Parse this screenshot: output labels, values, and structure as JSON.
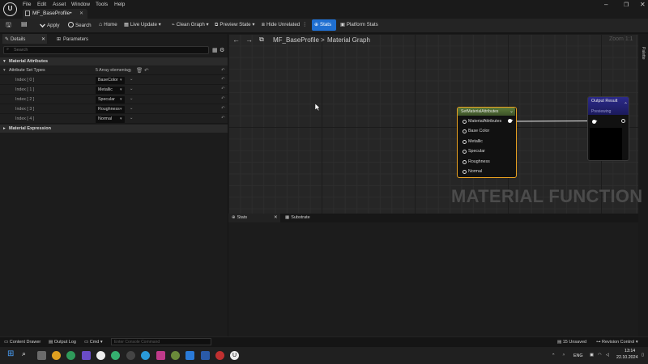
{
  "menu": [
    "File",
    "Edit",
    "Asset",
    "Window",
    "Tools",
    "Help"
  ],
  "document_tab": "MF_BaseProfile•",
  "toolbar": {
    "apply": "Apply",
    "search": "Search",
    "home": "Home",
    "live_update": "Live Update",
    "clean_graph": "Clean Graph",
    "preview_state": "Preview State",
    "hide_unrelated": "Hide Unrelated",
    "stats": "Stats",
    "platform_stats": "Platform Stats"
  },
  "details": {
    "tab_details": "Details",
    "tab_parameters": "Parameters",
    "search_placeholder": "Search",
    "category_material_attributes": "Material Attributes",
    "attribute_set_types_label": "Attribute Set Types",
    "array_count": "5 Array elements",
    "category_material_expression": "Material Expression",
    "rows": [
      {
        "label": "Index [ 0 ]",
        "value": "BaseColor"
      },
      {
        "label": "Index [ 1 ]",
        "value": "Metallic"
      },
      {
        "label": "Index [ 2 ]",
        "value": "Specular"
      },
      {
        "label": "Index [ 3 ]",
        "value": "Roughness"
      },
      {
        "label": "Index [ 4 ]",
        "value": "Normal"
      }
    ]
  },
  "graph": {
    "breadcrumb_asset": "MF_BaseProfile",
    "breadcrumb_separator": ">",
    "breadcrumb_graph": "Material Graph",
    "zoom": "Zoom 1:1",
    "watermark": "MATERIAL FUNCTION",
    "palette": "Palette",
    "set_node": {
      "title": "SetMaterialAttributes",
      "pins": [
        "MaterialAttributes",
        "Base Color",
        "Metallic",
        "Specular",
        "Roughness",
        "Normal"
      ]
    },
    "output_node": {
      "title": "Output Result",
      "subtitle": "Previewing"
    }
  },
  "bottom_tabs": {
    "stats": "Stats",
    "substrate": "Substrate"
  },
  "statusbar": {
    "content_drawer": "Content Drawer",
    "output_log": "Output Log",
    "cmd": "Cmd",
    "console_placeholder": "Enter Console Command",
    "unsaved": "15 Unsaved",
    "revision_control": "Revision Control"
  },
  "taskbar": {
    "language": "ENG",
    "time": "13:14",
    "date": "22.10.2024"
  },
  "colors": {
    "accent_blue": "#1f6fd1",
    "node_selected_border": "#e8a020",
    "set_node_header": "#4c6a32",
    "output_node_header": "#2c2a8a"
  }
}
